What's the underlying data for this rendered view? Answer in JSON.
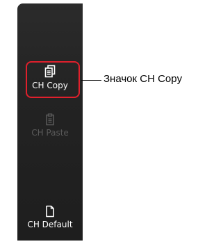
{
  "sidebar": {
    "buttons": [
      {
        "id": "copy",
        "label": "CH Copy",
        "icon": "copy-icon",
        "enabled": true
      },
      {
        "id": "paste",
        "label": "CH Paste",
        "icon": "paste-icon",
        "enabled": false
      },
      {
        "id": "default",
        "label": "CH Default",
        "icon": "document-icon",
        "enabled": true
      }
    ]
  },
  "annotation": {
    "callout_text": "Значок CH Copy",
    "highlight_color": "#e0202c"
  }
}
